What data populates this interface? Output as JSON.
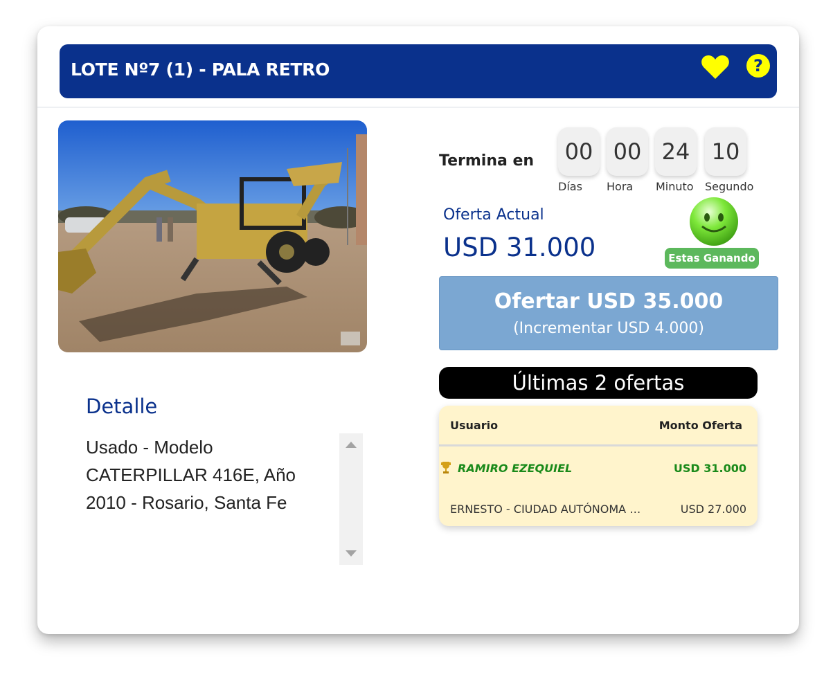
{
  "lot": {
    "title": "LOTE Nº7 (1) - PALA RETRO",
    "favorite_icon": "heart-icon",
    "help_icon": "question-mark-icon",
    "help_symbol": "?",
    "accent_color": "#0a318c",
    "icon_color": "#ffff00"
  },
  "countdown": {
    "label": "Termina en",
    "units": [
      {
        "value": "00",
        "label": "Días"
      },
      {
        "value": "00",
        "label": "Hora"
      },
      {
        "value": "24",
        "label": "Minuto"
      },
      {
        "value": "10",
        "label": "Segundo"
      }
    ]
  },
  "current_offer": {
    "label": "Oferta Actual",
    "value": "USD 31.000",
    "status_icon": "smiley-icon",
    "status_badge": "Estas Ganando",
    "status_color": "#5cb85c"
  },
  "bid_button": {
    "label": "Ofertar USD 35.000",
    "increment": "(Incrementar USD 4.000)"
  },
  "history": {
    "title": "Últimas 2 ofertas",
    "columns": [
      "Usuario",
      "Monto Oferta"
    ],
    "rows": [
      {
        "user": "RAMIRO EZEQUIEL",
        "amount": "USD 31.000",
        "leader": true
      },
      {
        "user": "ERNESTO - CIUDAD AUTÓNOMA D...",
        "amount": "USD 27.000",
        "leader": false
      }
    ]
  },
  "detail": {
    "title": "Detalle",
    "text": "Usado - Modelo CATERPILLAR 416E, Año 2010 - Rosario, Santa Fe"
  }
}
